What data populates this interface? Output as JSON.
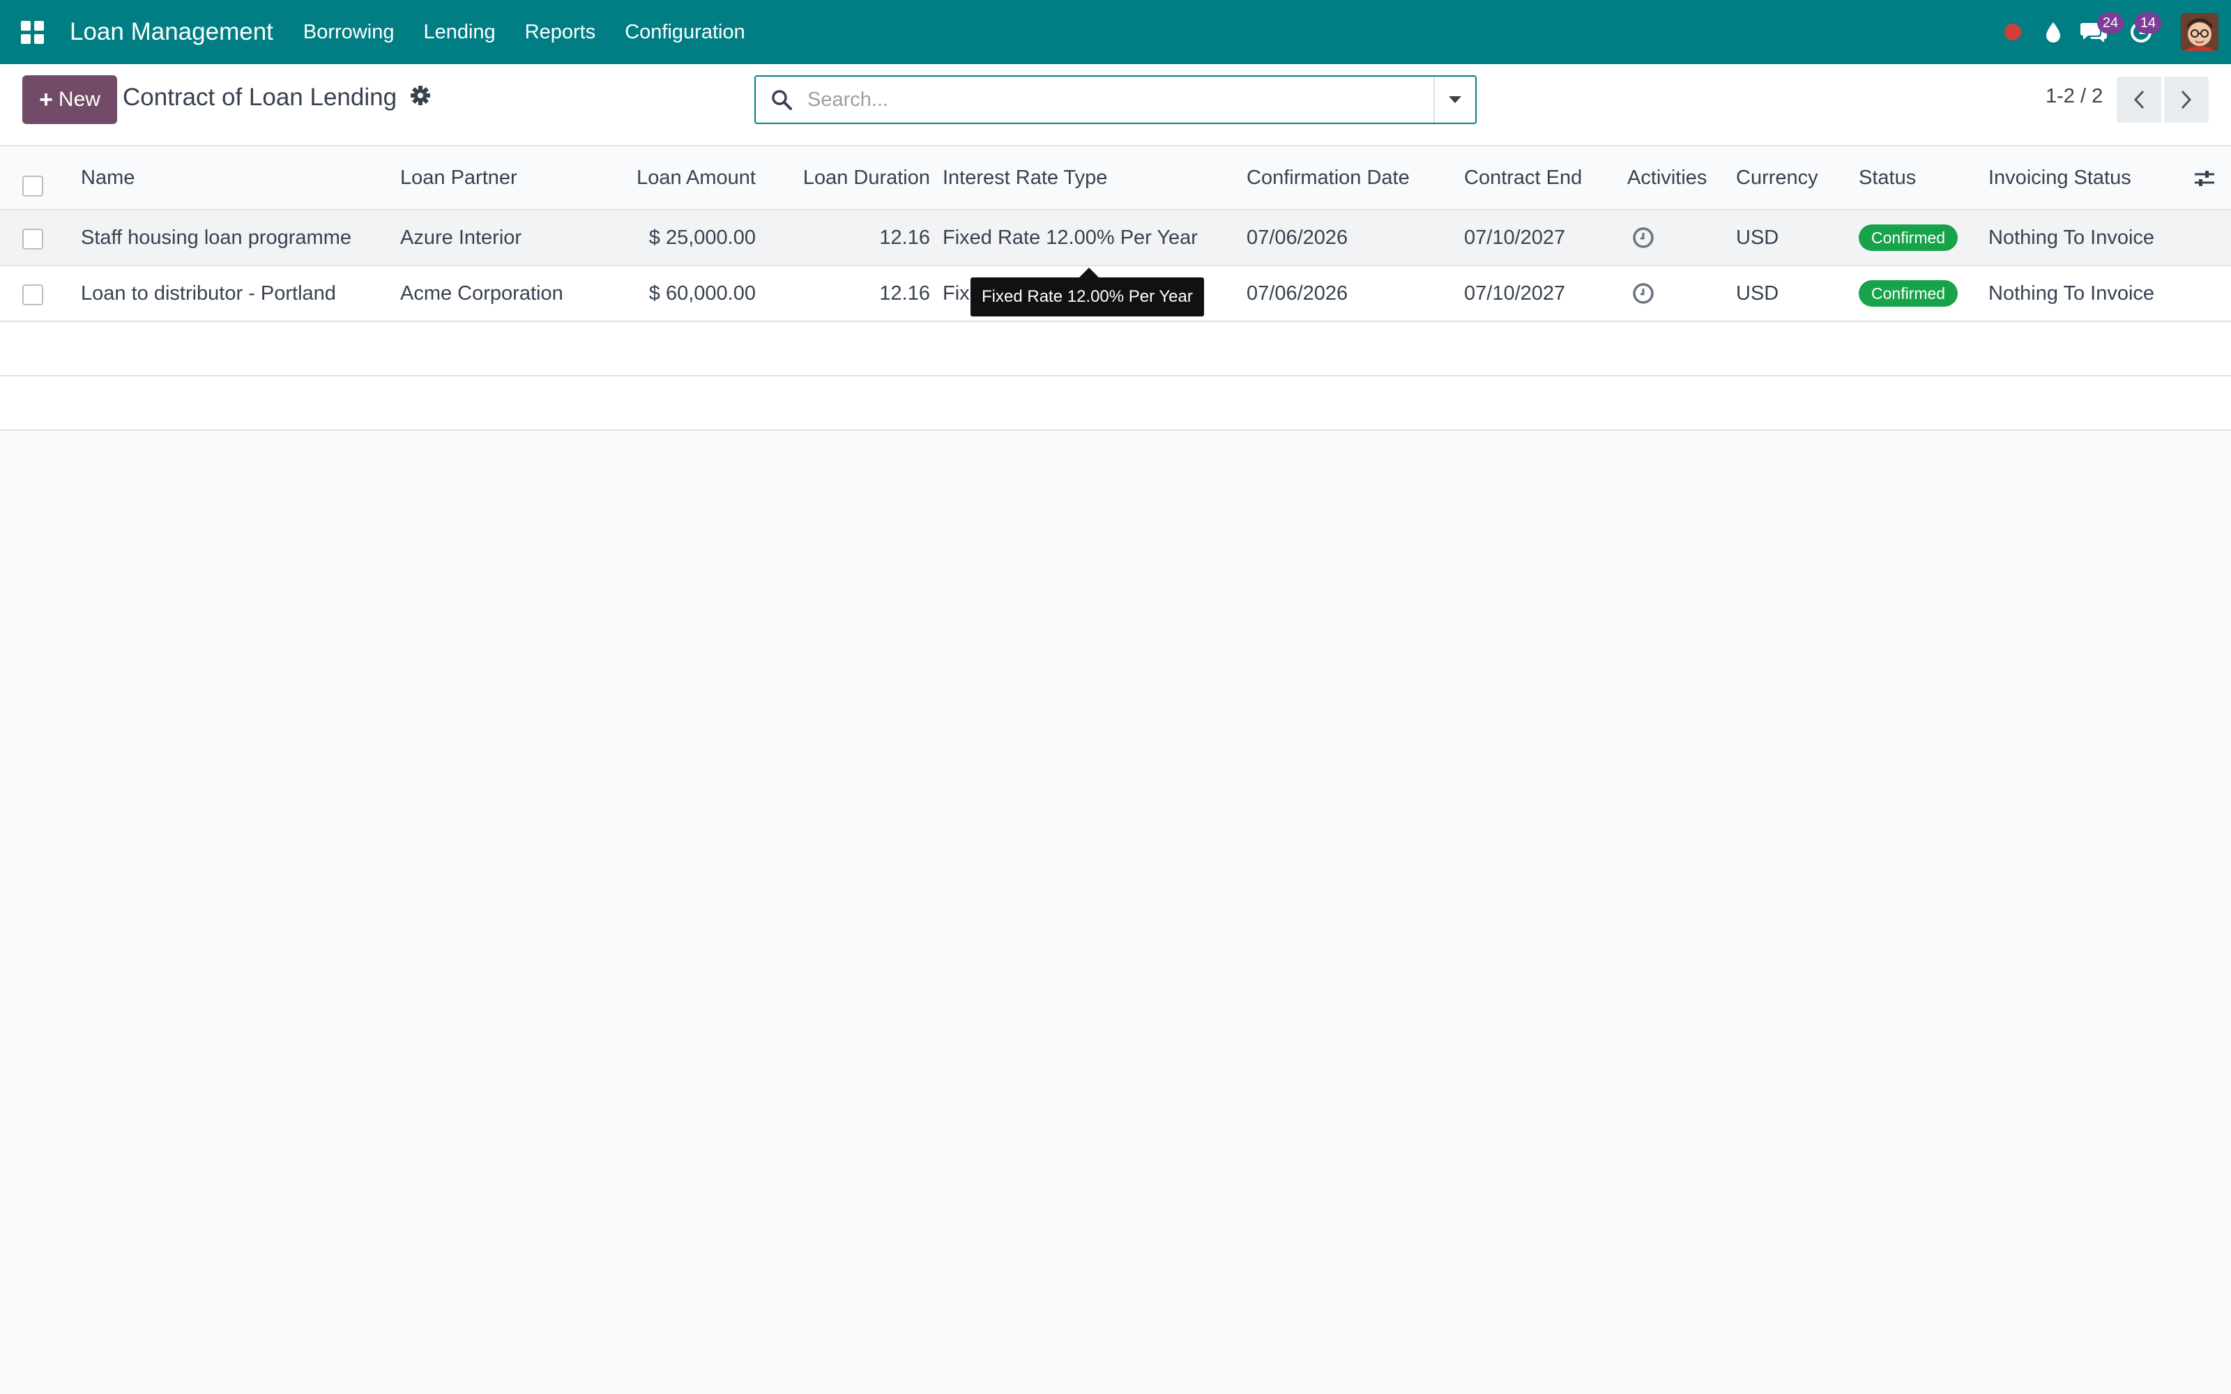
{
  "navbar": {
    "app_title": "Loan Management",
    "menu": [
      "Borrowing",
      "Lending",
      "Reports",
      "Configuration"
    ],
    "messages_count": "24",
    "activities_count": "14"
  },
  "control_panel": {
    "new_label": "New",
    "title": "Contract of Loan Lending",
    "search_placeholder": "Search...",
    "pager_value": "1-2 / 2"
  },
  "table": {
    "columns": [
      "Name",
      "Loan Partner",
      "Loan Amount",
      "Loan Duration",
      "Interest Rate Type",
      "Confirmation Date",
      "Contract End",
      "Activities",
      "Currency",
      "Status",
      "Invoicing Status"
    ],
    "rows": [
      {
        "name": "Staff housing loan programme",
        "partner": "Azure Interior",
        "amount": "$ 25,000.00",
        "duration": "12.16",
        "interest": "Fixed Rate 12.00% Per Year",
        "confirmation": "07/06/2026",
        "contract_end": "07/10/2027",
        "currency": "USD",
        "status": "Confirmed",
        "invoicing": "Nothing To Invoice"
      },
      {
        "name": "Loan to distributor - Portland",
        "partner": "Acme Corporation",
        "amount": "$ 60,000.00",
        "duration": "12.16",
        "interest": "Fixed Rate 12.00% Per Year",
        "confirmation": "07/06/2026",
        "contract_end": "07/10/2027",
        "currency": "USD",
        "status": "Confirmed",
        "invoicing": "Nothing To Invoice"
      }
    ]
  },
  "tooltip": {
    "text": "Fixed Rate 12.00% Per Year"
  },
  "colors": {
    "navbar": "#017e84",
    "primary_button": "#714b67",
    "status_confirmed": "#17a34a",
    "badge": "#7d3c98",
    "record_dot": "#d23f3a"
  }
}
